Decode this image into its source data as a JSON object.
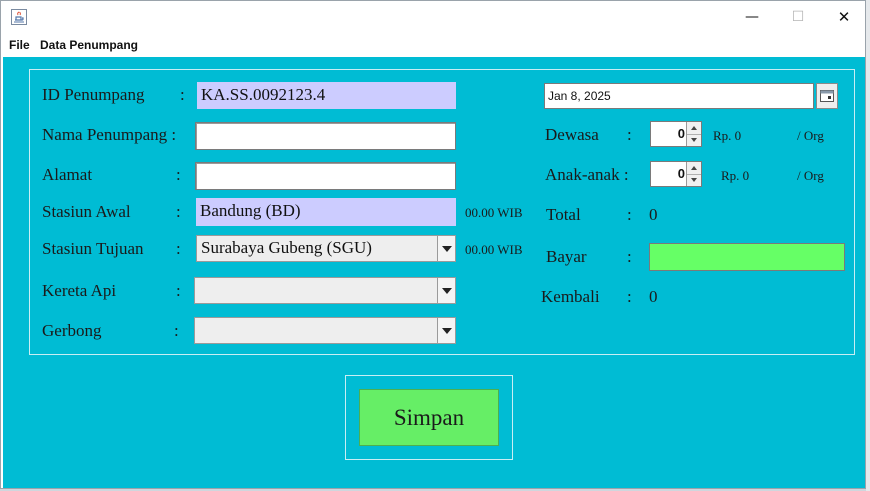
{
  "window": {
    "minimize_glyph": "—",
    "maximize_glyph": "☐",
    "close_glyph": "✕"
  },
  "menu": {
    "file": "File",
    "data_penumpang": "Data Penumpang"
  },
  "form": {
    "id_label": "ID Penumpang",
    "id_value": "KA.SS.0092123.4",
    "nama_label": "Nama Penumpang :",
    "nama_value": "",
    "alamat_label": "Alamat",
    "alamat_value": "",
    "stasiun_awal_label": "Stasiun Awal",
    "stasiun_awal_value": "Bandung (BD)",
    "stasiun_awal_time": "00.00 WIB",
    "stasiun_tujuan_label": "Stasiun Tujuan",
    "stasiun_tujuan_value": "Surabaya Gubeng (SGU)",
    "stasiun_tujuan_time": "00.00 WIB",
    "kereta_label": "Kereta Api",
    "kereta_value": "",
    "gerbong_label": "Gerbong",
    "gerbong_value": "",
    "colon": ":"
  },
  "booking": {
    "date_value": "Jan 8, 2025",
    "dewasa_label": "Dewasa",
    "dewasa_count": "0",
    "dewasa_price": "Rp.  0",
    "dewasa_unit": "/ Org",
    "anak_label": "Anak-anak :",
    "anak_count": "0",
    "anak_price": "Rp.  0",
    "anak_unit": "/ Org",
    "total_label": "Total",
    "total_value": "0",
    "bayar_label": "Bayar",
    "kembali_label": "Kembali",
    "kembali_value": "0",
    "colon": ":"
  },
  "actions": {
    "simpan": "Simpan"
  },
  "colors": {
    "content_bg": "#00bcd4",
    "readonly_field": "#ccccff",
    "bayar_field": "#66ff66",
    "save_button": "#66ee66"
  }
}
